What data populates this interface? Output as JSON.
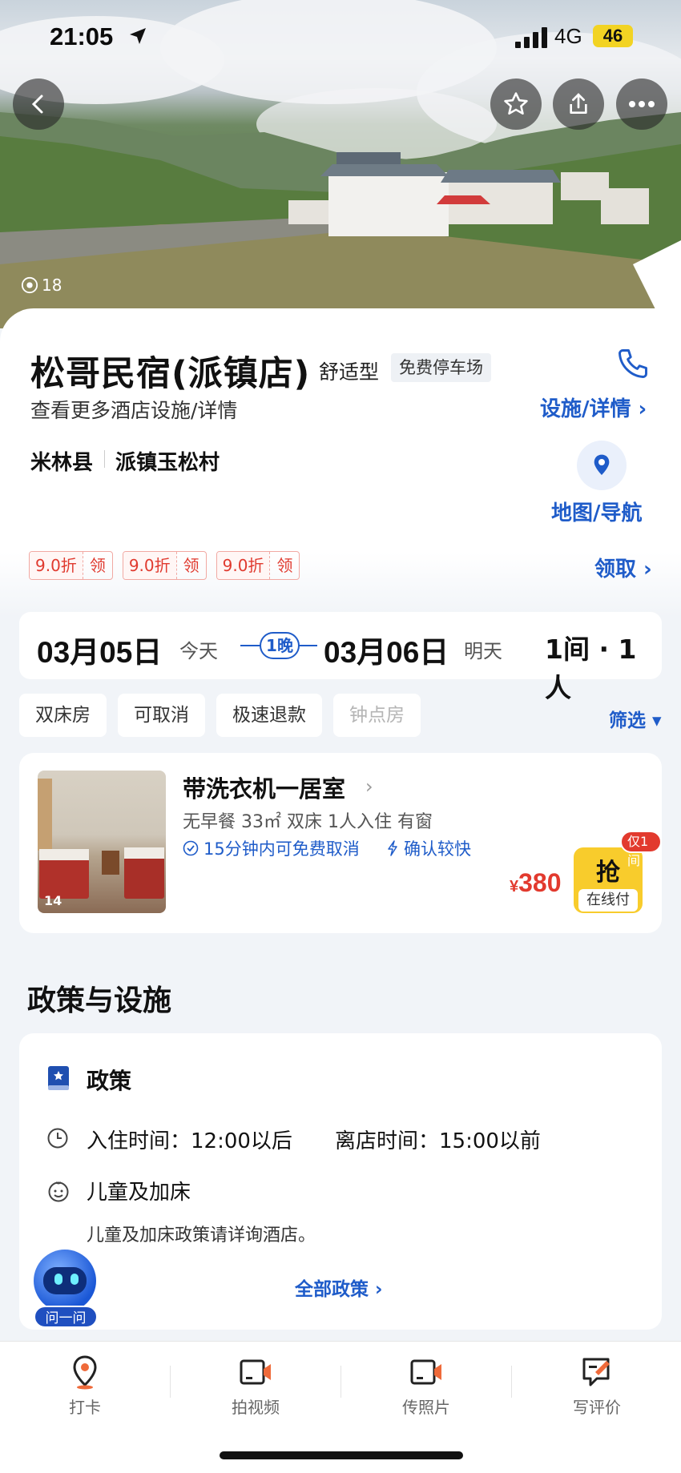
{
  "status_bar": {
    "time": "21:05",
    "network": "4G",
    "battery": "46"
  },
  "hero": {
    "photo_count": "18"
  },
  "hotel": {
    "name": "松哥民宿(派镇店)",
    "type": "舒适型",
    "tag": "免费停车场",
    "more_facilities": "查看更多酒店设施/详情",
    "facility_link": "设施/详情 ›",
    "district": "米林县",
    "address": "派镇玉松村",
    "map_label": "地图/导航"
  },
  "coupons": [
    {
      "discount": "9.0折",
      "action": "领"
    },
    {
      "discount": "9.0折",
      "action": "领"
    },
    {
      "discount": "9.0折",
      "action": "领"
    }
  ],
  "claim_link": "领取 ›",
  "dates": {
    "checkin": "03月05日",
    "checkin_sub": "今天",
    "nights": "1晚",
    "checkout": "03月06日",
    "checkout_sub": "明天",
    "rooms": "1间 · 1人"
  },
  "filters": [
    "双床房",
    "可取消",
    "极速退款",
    "钟点房"
  ],
  "filter_button": "筛选 ▾",
  "room": {
    "name": "带洗衣机一居室",
    "image_count": "14",
    "spec": "无早餐  33㎡  双床  1人入住  有窗",
    "cancel": "15分钟内可免费取消",
    "confirm": "确认较快",
    "currency": "¥",
    "price": "380",
    "badge": "仅1间",
    "grab_label": "抢",
    "grab_sub": "在线付"
  },
  "policy_section": {
    "title": "政策与设施",
    "policy_head": "政策",
    "checkin": "入住时间：12:00以后",
    "checkout": "离店时间：15:00以前",
    "child_head": "儿童及加床",
    "child_text": "儿童及加床政策请详询酒店。",
    "all_link": "全部政策 ›",
    "assistant": "问一问"
  },
  "tabbar": [
    {
      "label": "打卡",
      "icon": "location-pin-icon"
    },
    {
      "label": "拍视频",
      "icon": "video-icon"
    },
    {
      "label": "传照片",
      "icon": "photo-upload-icon"
    },
    {
      "label": "写评价",
      "icon": "write-review-icon"
    }
  ],
  "colors": {
    "accent": "#1f5cc9",
    "price": "#e23a2e",
    "grab": "#f8cc2c"
  }
}
